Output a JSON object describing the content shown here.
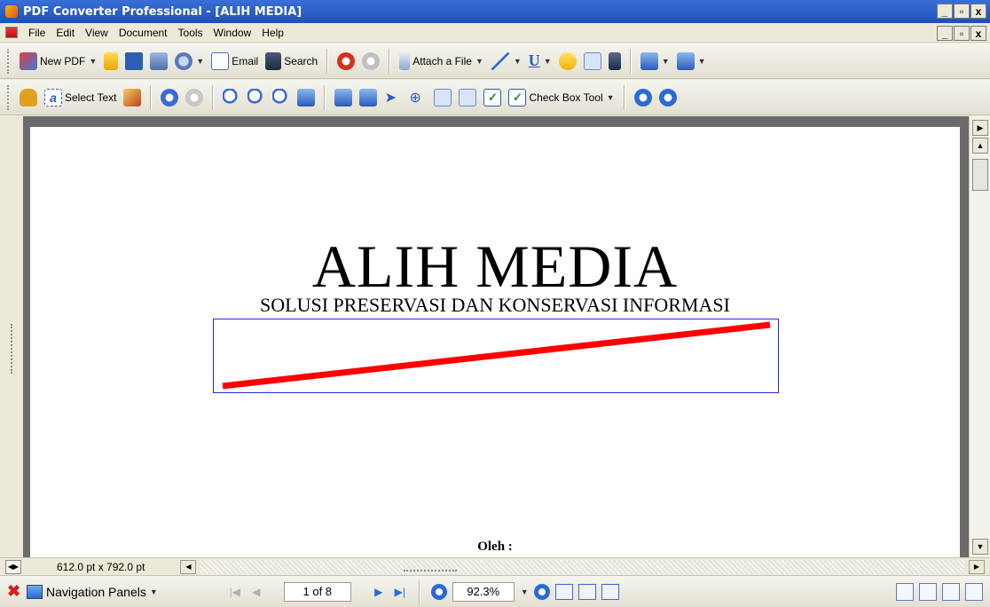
{
  "window": {
    "title": "PDF Converter Professional - [ALIH MEDIA]",
    "controls": [
      "_",
      "ё",
      "x"
    ]
  },
  "menu": {
    "items": [
      "File",
      "Edit",
      "View",
      "Document",
      "Tools",
      "Window",
      "Help"
    ],
    "controls": [
      "_",
      "ё",
      "x"
    ]
  },
  "toolbar1": {
    "new_pdf": "New PDF",
    "email": "Email",
    "search": "Search",
    "attach": "Attach a File"
  },
  "toolbar2": {
    "select_text": "Select Text",
    "check_box_tool": "Check Box Tool"
  },
  "document": {
    "title": "ALIH MEDIA",
    "subtitle": "SOLUSI PRESERVASI DAN KONSERVASI INFORMASI",
    "author_label": "Oleh :",
    "annotation_color": "#ff0000",
    "annotation_border": "#2a2ae0"
  },
  "status": {
    "page_size": "612.0 pt x 792.0 pt"
  },
  "navbar": {
    "navigation_panels": "Navigation Panels",
    "page_indicator": "1 of 8",
    "zoom": "92.3%"
  },
  "colors": {
    "titlebar": "#1e4fb8",
    "chrome": "#ece9d8",
    "viewer_bg": "#6b6b6b"
  }
}
